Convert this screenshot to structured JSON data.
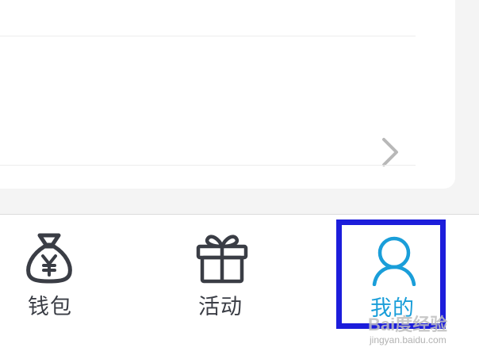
{
  "colors": {
    "active_tab": "#1a9ed9",
    "inactive_tab": "#3a3d45",
    "highlight_border": "#1c1ddb",
    "background": "#f4f4f4"
  },
  "list": {
    "rows": [
      {
        "chevron_icon": "chevron-right-icon"
      },
      {
        "chevron_icon": "chevron-right-icon"
      }
    ]
  },
  "tabbar": {
    "tabs": [
      {
        "label": "钱包",
        "icon": "money-bag-yen-icon",
        "active": false
      },
      {
        "label": "活动",
        "icon": "gift-icon",
        "active": false
      },
      {
        "label": "我的",
        "icon": "user-icon",
        "active": true
      }
    ]
  },
  "watermark": {
    "main": "Bai度经验",
    "sub": "jingyan.baidu.com"
  }
}
